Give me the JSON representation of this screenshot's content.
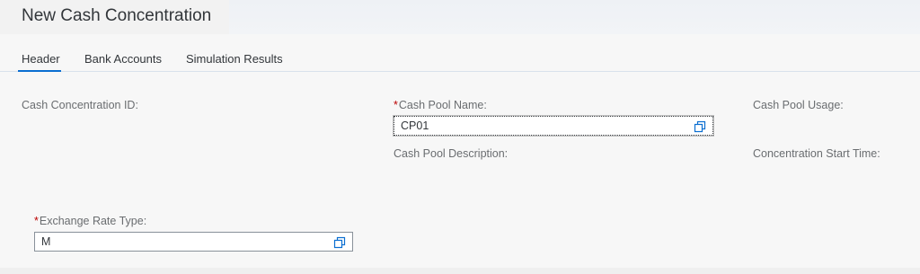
{
  "page": {
    "title": "New Cash Concentration"
  },
  "tabs": [
    {
      "label": "Header"
    },
    {
      "label": "Bank Accounts"
    },
    {
      "label": "Simulation Results"
    }
  ],
  "form": {
    "cash_concentration_id_label": "Cash Concentration ID:",
    "cash_pool_name_required": "*",
    "cash_pool_name_label": "Cash Pool Name:",
    "cash_pool_name_value": "CP01",
    "cash_pool_usage_label": "Cash Pool Usage:",
    "cash_pool_description_label": "Cash Pool Description:",
    "concentration_start_time_label": "Concentration Start Time:",
    "exchange_rate_type_required": "*",
    "exchange_rate_type_label": "Exchange Rate Type:",
    "exchange_rate_type_value": "M"
  },
  "icons": {
    "value_help": "value-help-icon"
  },
  "colors": {
    "accent": "#0a6ed1",
    "required": "#bb0000",
    "label": "#6a6d70",
    "text": "#32363a"
  }
}
